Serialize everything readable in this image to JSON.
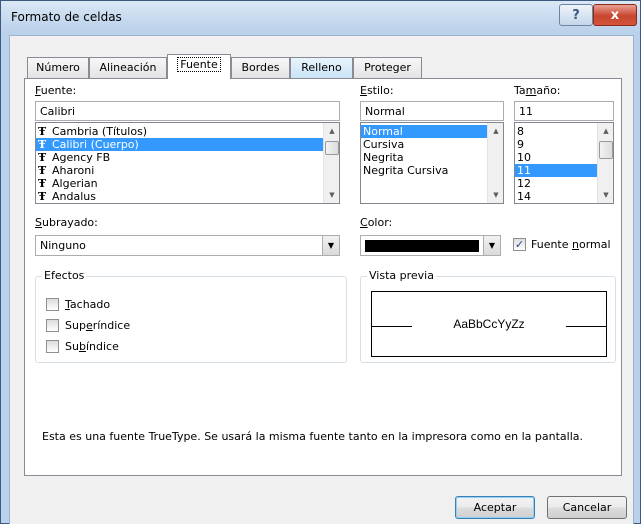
{
  "window": {
    "title": "Formato de celdas",
    "help_label": "?",
    "close_label": "x"
  },
  "tabs": [
    {
      "label": "Número"
    },
    {
      "label": "Alineación"
    },
    {
      "label": "Fuente"
    },
    {
      "label": "Bordes"
    },
    {
      "label": "Relleno"
    },
    {
      "label": "Proteger"
    }
  ],
  "active_tab": "Fuente",
  "font": {
    "label_prefix": "F",
    "label_rest": "uente:",
    "value": "Calibri",
    "items": [
      {
        "label": "Cambria (Títulos)",
        "selected": false
      },
      {
        "label": "Calibri (Cuerpo)",
        "selected": true
      },
      {
        "label": "Agency FB",
        "selected": false
      },
      {
        "label": "Aharoni",
        "selected": false
      },
      {
        "label": "Algerian",
        "selected": false
      },
      {
        "label": "Andalus",
        "selected": false
      }
    ],
    "icon_glyph": "Ŧ"
  },
  "style": {
    "label_prefix": "E",
    "label_rest": "stilo:",
    "value": "Normal",
    "items": [
      {
        "label": "Normal",
        "selected": true
      },
      {
        "label": "Cursiva",
        "selected": false
      },
      {
        "label": "Negrita",
        "selected": false
      },
      {
        "label": "Negrita Cursiva",
        "selected": false
      }
    ]
  },
  "size": {
    "label_pre": "Ta",
    "label_u": "m",
    "label_rest": "año:",
    "value": "11",
    "items": [
      {
        "label": "8",
        "selected": false
      },
      {
        "label": "9",
        "selected": false
      },
      {
        "label": "10",
        "selected": false
      },
      {
        "label": "11",
        "selected": true
      },
      {
        "label": "12",
        "selected": false
      },
      {
        "label": "14",
        "selected": false
      }
    ]
  },
  "underline": {
    "label_prefix": "S",
    "label_rest": "ubrayado:",
    "value": "Ninguno"
  },
  "color": {
    "label_prefix": "C",
    "label_rest": "olor:",
    "swatch": "#000000"
  },
  "normal_font": {
    "label_pre": "Fuente ",
    "label_u": "n",
    "label_rest": "ormal",
    "checked": true
  },
  "effects": {
    "title": "Efectos",
    "items": [
      {
        "pre": "",
        "u": "T",
        "rest": "achado",
        "checked": false
      },
      {
        "pre": "Sup",
        "u": "e",
        "rest": "ríndice",
        "checked": false
      },
      {
        "pre": "Su",
        "u": "b",
        "rest": "índice",
        "checked": false
      }
    ]
  },
  "preview": {
    "title": "Vista previa",
    "sample": "AaBbCcYyZz"
  },
  "info_text": "Esta es una fuente TrueType. Se usará la misma fuente tanto en la impresora como en la pantalla.",
  "buttons": {
    "accept": "Aceptar",
    "cancel": "Cancelar"
  },
  "colors": {
    "selection": "#3399ff",
    "title_bar": "#c4d8ee"
  }
}
